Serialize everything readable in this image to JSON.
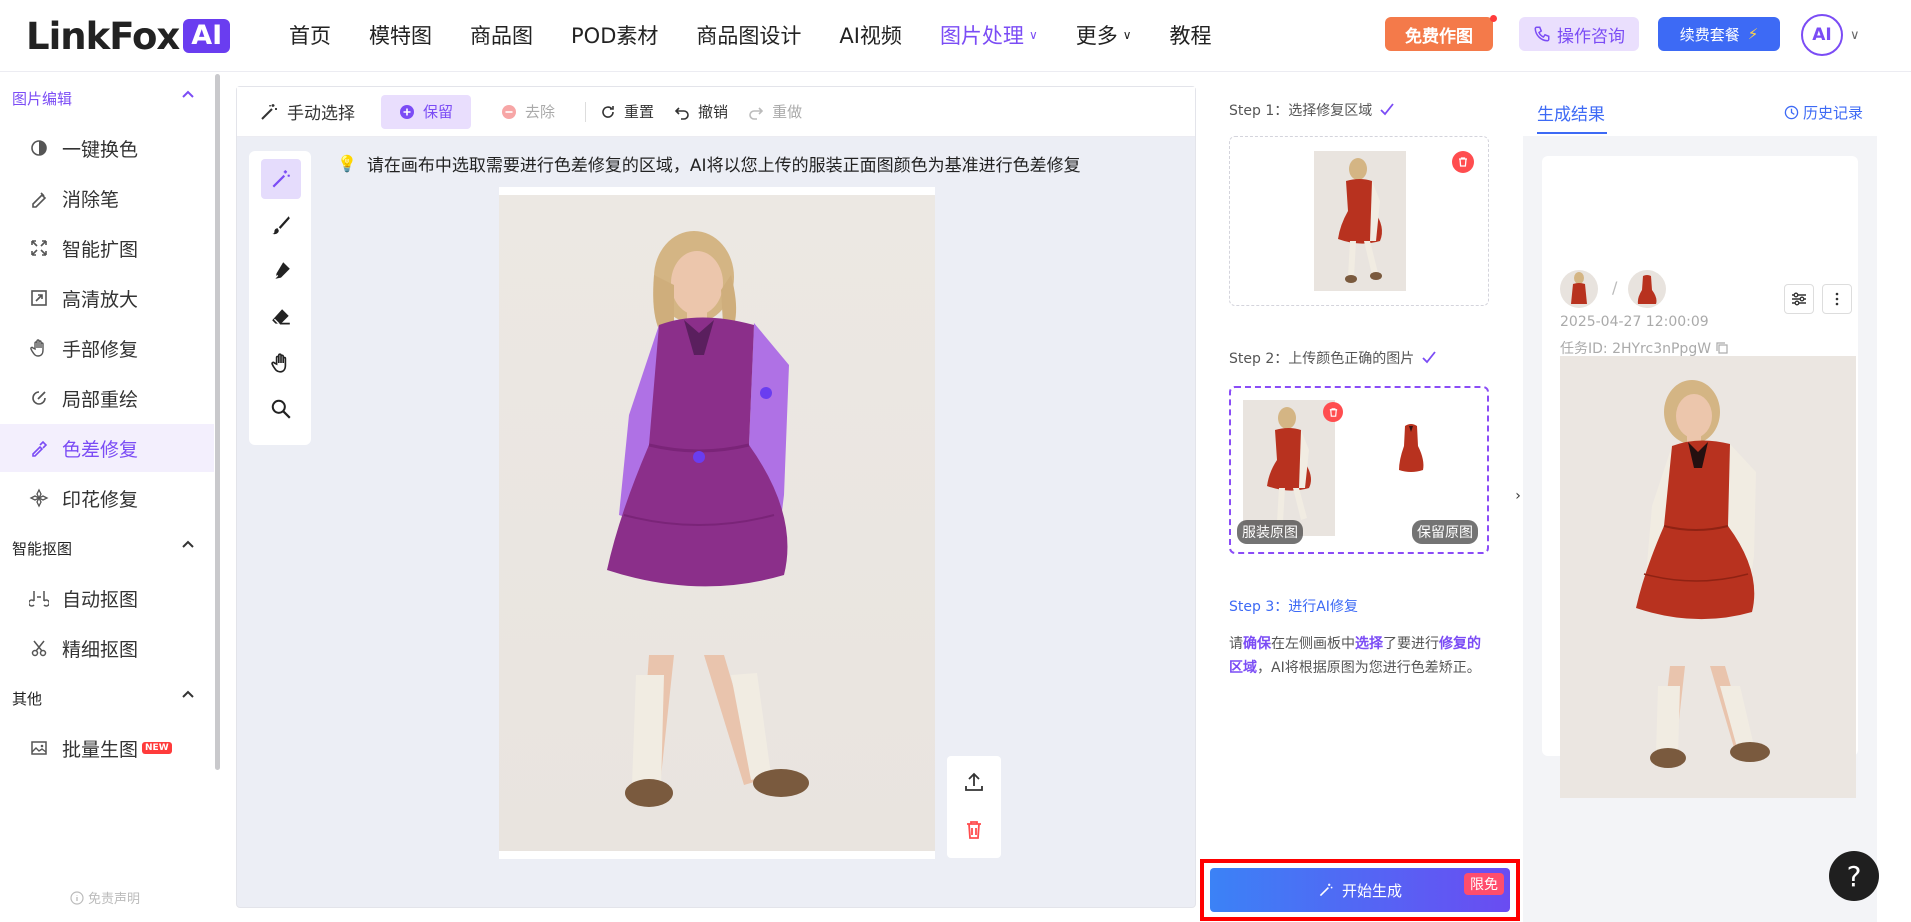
{
  "header": {
    "logo_text": "LinkFox",
    "logo_badge": "AI",
    "nav": [
      {
        "label": "首页"
      },
      {
        "label": "模特图"
      },
      {
        "label": "商品图"
      },
      {
        "label": "POD素材"
      },
      {
        "label": "商品图设计"
      },
      {
        "label": "AI视频"
      },
      {
        "label": "图片处理"
      },
      {
        "label": "更多"
      },
      {
        "label": "教程"
      }
    ],
    "free_btn": "免费作图",
    "consult_btn": "操作咨询",
    "renew_btn": "续费套餐",
    "avatar_text": "AI"
  },
  "sidebar": {
    "sections": [
      {
        "title": "图片编辑"
      },
      {
        "title": "智能抠图"
      },
      {
        "title": "其他"
      }
    ],
    "items": [
      {
        "label": "一键换色",
        "icon": "color-swap-icon"
      },
      {
        "label": "消除笔",
        "icon": "eraser-pen-icon"
      },
      {
        "label": "智能扩图",
        "icon": "expand-icon"
      },
      {
        "label": "高清放大",
        "icon": "upscale-icon"
      },
      {
        "label": "手部修复",
        "icon": "hand-icon"
      },
      {
        "label": "局部重绘",
        "icon": "repaint-icon"
      },
      {
        "label": "色差修复",
        "icon": "color-fix-icon"
      },
      {
        "label": "印花修复",
        "icon": "print-fix-icon"
      },
      {
        "label": "自动抠图",
        "icon": "auto-cutout-icon"
      },
      {
        "label": "精细抠图",
        "icon": "fine-cutout-icon"
      },
      {
        "label": "批量生图",
        "icon": "batch-image-icon",
        "badge": "NEW"
      }
    ],
    "disclaimer": "免责声明"
  },
  "toolbar": {
    "manual_select": "手动选择",
    "keep": "保留",
    "remove": "去除",
    "reset": "重置",
    "undo": "撤销",
    "redo": "重做"
  },
  "canvas": {
    "hint": "请在画布中选取需要进行色差修复的区域，AI将以您上传的服装正面图颜色为基准进行色差修复"
  },
  "steps": {
    "step1": "Step 1：选择修复区域",
    "step2": "Step 2：上传颜色正确的图片",
    "step3": "Step 3：进行AI修复",
    "tag_original": "服装原图",
    "tag_keep": "保留原图",
    "desc_1": "请",
    "desc_2": "确保",
    "desc_3": "在左侧画板中",
    "desc_4": "选择",
    "desc_5": "了要进行",
    "desc_6": "修复的区域",
    "desc_7": "，AI将根据原图为您进行色差矫正。",
    "generate": "开始生成",
    "free_tag": "限免"
  },
  "results": {
    "tab": "生成结果",
    "history": "历史记录",
    "slash": "/",
    "time": "2025-04-27 12:00:09",
    "task_id": "任务ID: 2HYrc3nPpgW"
  },
  "colors": {
    "accent": "#7b4cf5",
    "blue": "#3d6af5",
    "mask": "#a15ce8",
    "dress": "#b8321f"
  }
}
